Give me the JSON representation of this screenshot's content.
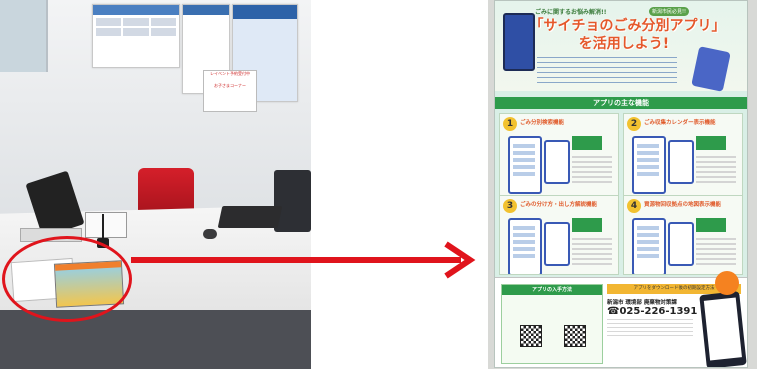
{
  "left_photo": {
    "wall_signs": [
      "レイベント予約受付中",
      "お子さまコーナー"
    ]
  },
  "right_photo": {
    "poster": {
      "subtitle": "ごみに関するお悩み解消!!",
      "category_badge": "新潟市民必見!!",
      "title": "「サイチョのごみ分別アプリ」を活用しよう!",
      "section_title": "アプリの主な機能",
      "features": [
        {
          "number": "1",
          "title": "ごみ分別検索機能"
        },
        {
          "number": "2",
          "title": "ごみ収集カレンダー表示機能"
        },
        {
          "number": "3",
          "title": "ごみの分け方・出し方解説機能"
        },
        {
          "number": "4",
          "title": "資源物回収拠点の地図表示機能"
        }
      ],
      "howto_title": "アプリの入手方法",
      "contact_bar": "アプリをダウンロード後の初期設定方法",
      "contact_org": "新潟市 環境部 廃棄物対策課",
      "contact_tel": "☎025-226-1391"
    }
  },
  "colors": {
    "highlight_red": "#e0141c",
    "poster_green": "#2e9b4b",
    "title_orange": "#e5582b"
  }
}
